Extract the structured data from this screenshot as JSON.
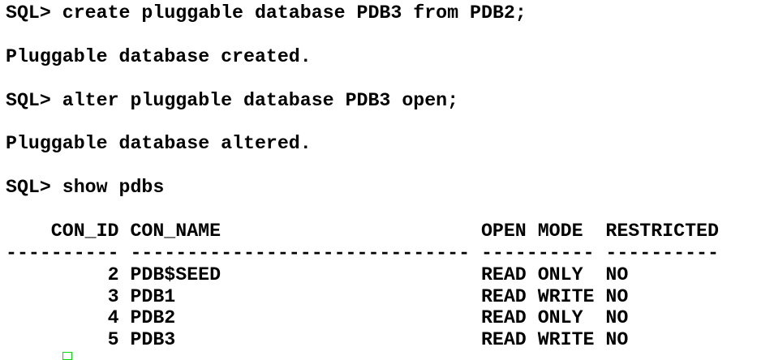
{
  "session": [
    "SQL> create pluggable database PDB3 from PDB2;",
    "",
    "Pluggable database created.",
    "",
    "SQL> alter pluggable database PDB3 open;",
    "",
    "Pluggable database altered.",
    "",
    "SQL> show pdbs",
    ""
  ],
  "pdbs": {
    "headers": [
      "CON_ID",
      "CON_NAME",
      "OPEN MODE",
      "RESTRICTED"
    ],
    "separators": [
      "----------",
      "------------------------------",
      "----------",
      "----------"
    ],
    "rows": [
      [
        "2",
        "PDB$SEED",
        "READ ONLY",
        "NO"
      ],
      [
        "3",
        "PDB1",
        "READ WRITE",
        "NO"
      ],
      [
        "4",
        "PDB2",
        "READ ONLY",
        "NO"
      ],
      [
        "5",
        "PDB3",
        "READ WRITE",
        "NO"
      ]
    ]
  },
  "cursor_color": "#00e000"
}
